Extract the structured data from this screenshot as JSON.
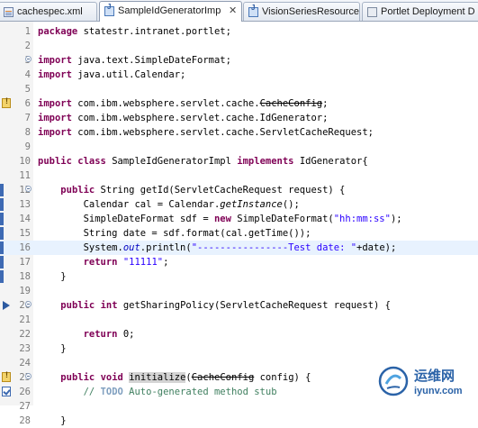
{
  "tabs": [
    {
      "label": "cachespec.xml",
      "icon": "xml-file-icon",
      "active": false
    },
    {
      "label": "SampleIdGeneratorImp",
      "icon": "java-file-icon",
      "active": true,
      "close": "✕"
    },
    {
      "label": "VisionSeriesResource",
      "icon": "java-file-icon",
      "active": false
    },
    {
      "label": "Portlet Deployment D",
      "icon": "portlet-descriptor-icon",
      "active": false
    }
  ],
  "line_numbers": [
    "1",
    "2",
    "3",
    "4",
    "5",
    "6",
    "7",
    "8",
    "9",
    "10",
    "11",
    "12",
    "13",
    "14",
    "15",
    "16",
    "17",
    "18",
    "19",
    "20",
    "21",
    "22",
    "23",
    "24",
    "25",
    "26",
    "27",
    "28"
  ],
  "code": {
    "l1a": "package",
    "l1b": " statestr.intranet.portlet;",
    "l3a": "import",
    "l3b": " java.text.SimpleDateFormat;",
    "l4a": "import",
    "l4b": " java.util.Calendar;",
    "l6a": "import",
    "l6b": " com.ibm.websphere.servlet.cache.",
    "l6c": "CacheConfig",
    "l6d": ";",
    "l7a": "import",
    "l7b": " com.ibm.websphere.servlet.cache.IdGenerator;",
    "l8a": "import",
    "l8b": " com.ibm.websphere.servlet.cache.ServletCacheRequest;",
    "l10a": "public",
    "l10b": " ",
    "l10c": "class",
    "l10d": " SampleIdGeneratorImpl ",
    "l10e": "implements",
    "l10f": " IdGenerator{",
    "l12a": "    ",
    "l12b": "public",
    "l12c": " String getId(ServletCacheRequest request) {",
    "l13a": "        Calendar cal = Calendar.",
    "l13b": "getInstance",
    "l13c": "();",
    "l14a": "        SimpleDateFormat sdf = ",
    "l14b": "new",
    "l14c": " SimpleDateFormat(",
    "l14d": "\"hh:mm:ss\"",
    "l14e": ");",
    "l15a": "        String date = sdf.format(cal.getTime());",
    "l16a": "        System.",
    "l16b": "out",
    "l16c": ".println(",
    "l16d": "\"----------------Test date: \"",
    "l16e": "+date);",
    "l17a": "        ",
    "l17b": "return",
    "l17c": " ",
    "l17d": "\"11111\"",
    "l17e": ";",
    "l18a": "    }",
    "l20a": "    ",
    "l20b": "public",
    "l20c": " ",
    "l20d": "int",
    "l20e": " getSharingPolicy(ServletCacheRequest request) {",
    "l22a": "        ",
    "l22b": "return",
    "l22c": " 0;",
    "l23a": "    }",
    "l25a": "    ",
    "l25b": "public",
    "l25c": " ",
    "l25d": "void",
    "l25e": " ",
    "l25f": "initialize",
    "l25g": "(",
    "l25h": "CacheConfig",
    "l25i": " config) {",
    "l26a": "        ",
    "l26b": "// ",
    "l26c": "TODO",
    "l26d": " Auto-generated method stub",
    "l28a": "    }"
  },
  "watermark": {
    "cn": "运维网",
    "url": "iyunv.com"
  },
  "colors": {
    "keyword": "#7f0055",
    "string": "#2a00ff",
    "comment": "#3f7f5f",
    "current_line": "#e8f2fe"
  }
}
